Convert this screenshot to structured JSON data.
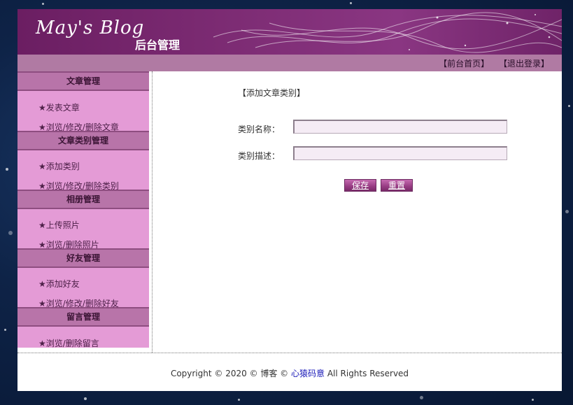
{
  "header": {
    "logo_text": "May's Blog",
    "subtitle": "后台管理"
  },
  "topbar": {
    "home_link": "【前台首页】",
    "logout_link": "【退出登录】"
  },
  "sidebar": {
    "sections": [
      {
        "title": "文章管理",
        "items": [
          "★发表文章",
          "★浏览/修改/删除文章"
        ]
      },
      {
        "title": "文章类别管理",
        "items": [
          "★添加类别",
          "★浏览/修改/删除类别"
        ]
      },
      {
        "title": "相册管理",
        "items": [
          "★上传照片",
          "★浏览/删除照片"
        ]
      },
      {
        "title": "好友管理",
        "items": [
          "★添加好友",
          "★浏览/修改/删除好友"
        ]
      },
      {
        "title": "留言管理",
        "items": [
          "★浏览/删除留言"
        ]
      }
    ]
  },
  "form": {
    "title": "【添加文章类别】",
    "name_label": "类别名称：",
    "name_value": "",
    "desc_label": "类别描述：",
    "desc_value": "",
    "save_label": "保存",
    "reset_label": "重置"
  },
  "footer": {
    "copyright_prefix": "Copyright © 2020 © 博客 © ",
    "site_link": "心猿码意",
    "copyright_suffix": " All Rights Reserved"
  },
  "colors": {
    "banner": "#7d2c74",
    "topbar": "#b07aa3",
    "sidebar": "#e49bd6",
    "section_head": "#b874a9",
    "button": "#9a3f86"
  }
}
